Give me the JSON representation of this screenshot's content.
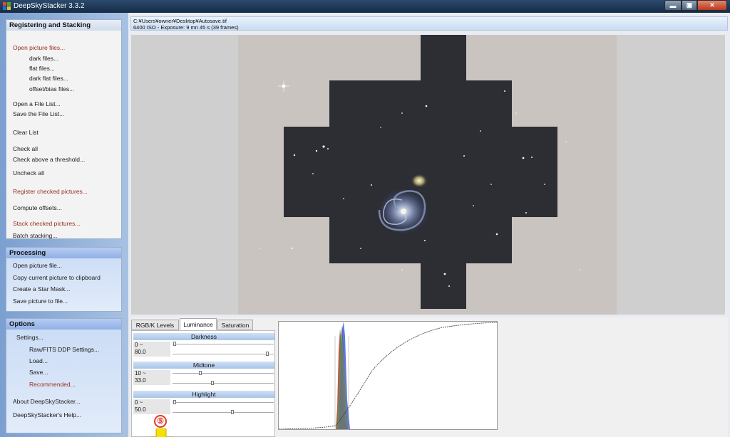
{
  "window": {
    "title": "DeepSkyStacker 3.3.2",
    "min_glyph": "▬",
    "max_glyph": "▣",
    "close_glyph": "✕"
  },
  "sidebar": {
    "registering": {
      "header": "Registering and Stacking",
      "items": [
        "Open picture files...",
        "dark files...",
        "flat files...",
        "dark flat files...",
        "offset/bias files...",
        "Open a File List...",
        "Save the File List...",
        "Clear List",
        "Check all",
        "Check above a threshold...",
        "Uncheck all",
        "Register checked pictures...",
        "Compute offsets...",
        "Stack checked pictures...",
        "Batch stacking..."
      ]
    },
    "processing": {
      "header": "Processing",
      "items": [
        "Open picture file...",
        "Copy current picture to clipboard",
        "Create a Star Mask...",
        "Save picture to file..."
      ]
    },
    "options": {
      "header": "Options",
      "items": [
        "Settings...",
        "Raw/FITS DDP Settings...",
        "Load...",
        "Save...",
        "Recommended...",
        "About DeepSkyStacker...",
        "DeepSkyStacker's Help..."
      ]
    }
  },
  "info": {
    "path": "C:¥Users¥owner¥Desktop¥Autosave.tif",
    "exposure": "6400 ISO - Exposure: 9 mn 45 s (39 frames)"
  },
  "tabs": {
    "rgb": "RGB/K Levels",
    "luminance": "Luminance",
    "saturation": "Saturation"
  },
  "luminance": {
    "darkness": {
      "label": "Darkness",
      "range": "0 ~",
      "value": "80.0"
    },
    "midtone": {
      "label": "Midtone",
      "range": "10 ~",
      "value": "33.0"
    },
    "highlight": {
      "label": "Highlight",
      "range": "0 ~",
      "value": "50.0"
    }
  },
  "annotation": {
    "step_number": "⑤",
    "color": "#e23a24",
    "arrow_color": "#f5e100"
  },
  "colors": {
    "sidebar_red": "#9a2f1e",
    "sky": "#2c2e33",
    "background": "#cac4c1"
  }
}
